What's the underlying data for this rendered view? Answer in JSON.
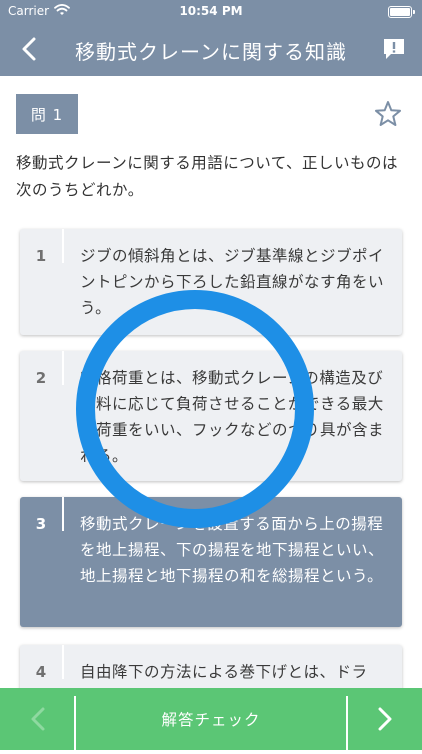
{
  "status": {
    "carrier": "Carrier",
    "time": "10:54 PM"
  },
  "nav": {
    "title": "移動式クレーンに関する知識"
  },
  "question": {
    "badge": "問 1",
    "text": "移動式クレーンに関する用語について、正しいものは次のうちどれか。",
    "starred": false
  },
  "options": [
    {
      "number": "1",
      "text": "ジブの傾斜角とは、ジブ基準線とジブポイントピンから下ろした鉛直線がなす角をいう。",
      "selected": false
    },
    {
      "number": "2",
      "text": "定格荷重とは、移動式クレーンの構造及び材料に応じて負荷させることができる最大の荷重をいい、フックなどのつり具が含まれる。",
      "selected": false
    },
    {
      "number": "3",
      "text": "移動式クレーンを設置する面から上の揚程を地上揚程、下の揚程を地下揚程といい、地上揚程と地下揚程の和を総揚程という。",
      "selected": true
    },
    {
      "number": "4",
      "text": "自由降下の方法による巻下げとは、ドラ",
      "selected": false
    }
  ],
  "footer": {
    "check_label": "解答チェック"
  },
  "colors": {
    "primary": "#7c8fa6",
    "accent": "#1e8fe6",
    "footer": "#5bc675"
  }
}
